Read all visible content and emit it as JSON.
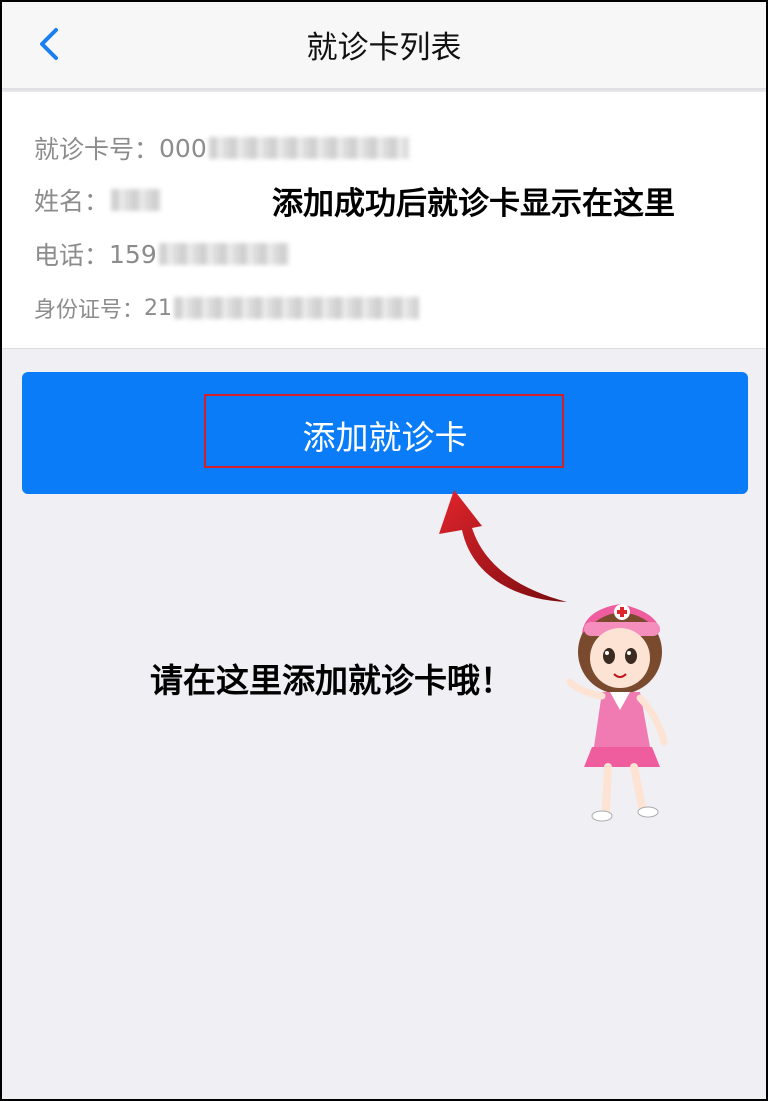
{
  "header": {
    "title": "就诊卡列表",
    "back_icon": "chevron-left-icon"
  },
  "card": {
    "card_number_label": "就诊卡号：",
    "card_number_visible": "000",
    "name_label": "姓名：",
    "phone_label": "电话：",
    "phone_visible": "159",
    "id_label": "身份证号：",
    "id_visible": "21"
  },
  "annotations": {
    "card_note": "添加成功后就诊卡显示在这里",
    "hint": "请在这里添加就诊卡哦！"
  },
  "add_button": {
    "label": "添加就诊卡"
  },
  "colors": {
    "accent": "#0a7cf8",
    "highlight": "#d4202b",
    "arrow": "#c0161d",
    "background": "#f0eff4"
  }
}
